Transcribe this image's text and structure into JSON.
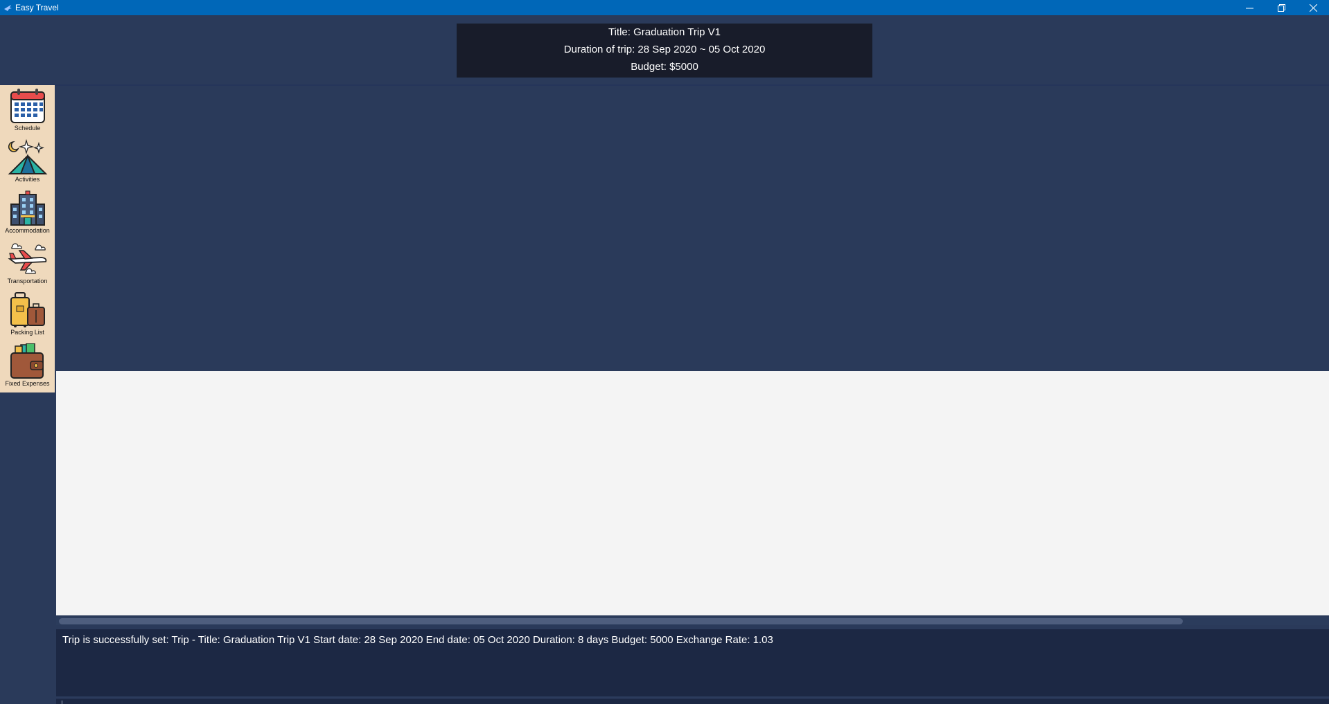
{
  "window": {
    "title": "Easy Travel",
    "controls": [
      "minimize",
      "restore",
      "close"
    ]
  },
  "trip_header": {
    "title_line": "Title: Graduation Trip V1",
    "duration_line": "Duration of trip: 28 Sep 2020 ~ 05 Oct 2020",
    "budget_line": "Budget: $5000"
  },
  "sidebar": {
    "items": [
      {
        "label": "Schedule",
        "icon": "calendar-icon"
      },
      {
        "label": "Activities",
        "icon": "tent-icon"
      },
      {
        "label": "Accommodation",
        "icon": "hotel-icon"
      },
      {
        "label": "Transportation",
        "icon": "airplane-icon"
      },
      {
        "label": "Packing List",
        "icon": "luggage-icon"
      },
      {
        "label": "Fixed Expenses",
        "icon": "wallet-icon"
      }
    ]
  },
  "result_display": {
    "text": "Trip is successfully set: Trip - Title: Graduation Trip V1 Start date: 28 Sep 2020 End date: 05 Oct 2020 Duration: 8 days Budget: 5000 Exchange Rate: 1.03"
  },
  "command_box": {
    "value": ""
  }
}
